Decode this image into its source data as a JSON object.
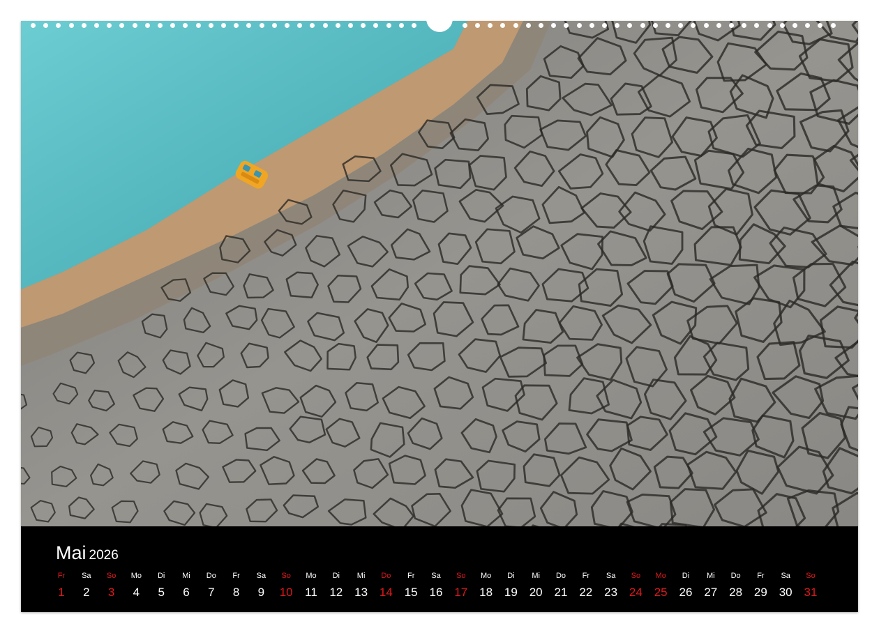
{
  "calendar": {
    "month": "Mai",
    "year": "2026",
    "holiday_color": "#e0181b",
    "days": [
      {
        "wd": "Fr",
        "d": "1",
        "holiday": true
      },
      {
        "wd": "Sa",
        "d": "2",
        "holiday": false
      },
      {
        "wd": "So",
        "d": "3",
        "holiday": true
      },
      {
        "wd": "Mo",
        "d": "4",
        "holiday": false
      },
      {
        "wd": "Di",
        "d": "5",
        "holiday": false
      },
      {
        "wd": "Mi",
        "d": "6",
        "holiday": false
      },
      {
        "wd": "Do",
        "d": "7",
        "holiday": false
      },
      {
        "wd": "Fr",
        "d": "8",
        "holiday": false
      },
      {
        "wd": "Sa",
        "d": "9",
        "holiday": false
      },
      {
        "wd": "So",
        "d": "10",
        "holiday": true
      },
      {
        "wd": "Mo",
        "d": "11",
        "holiday": false
      },
      {
        "wd": "Di",
        "d": "12",
        "holiday": false
      },
      {
        "wd": "Mi",
        "d": "13",
        "holiday": false
      },
      {
        "wd": "Do",
        "d": "14",
        "holiday": true
      },
      {
        "wd": "Fr",
        "d": "15",
        "holiday": false
      },
      {
        "wd": "Sa",
        "d": "16",
        "holiday": false
      },
      {
        "wd": "So",
        "d": "17",
        "holiday": true
      },
      {
        "wd": "Mo",
        "d": "18",
        "holiday": false
      },
      {
        "wd": "Di",
        "d": "19",
        "holiday": false
      },
      {
        "wd": "Mi",
        "d": "20",
        "holiday": false
      },
      {
        "wd": "Do",
        "d": "21",
        "holiday": false
      },
      {
        "wd": "Fr",
        "d": "22",
        "holiday": false
      },
      {
        "wd": "Sa",
        "d": "23",
        "holiday": false
      },
      {
        "wd": "So",
        "d": "24",
        "holiday": true
      },
      {
        "wd": "Mo",
        "d": "25",
        "holiday": true
      },
      {
        "wd": "Di",
        "d": "26",
        "holiday": false
      },
      {
        "wd": "Mi",
        "d": "27",
        "holiday": false
      },
      {
        "wd": "Do",
        "d": "28",
        "holiday": false
      },
      {
        "wd": "Fr",
        "d": "29",
        "holiday": false
      },
      {
        "wd": "Sa",
        "d": "30",
        "holiday": false
      },
      {
        "wd": "So",
        "d": "31",
        "holiday": true
      }
    ]
  },
  "photo": {
    "subject": "aerial-dry-cracked-lakebed",
    "colors": {
      "water": "#5bbcc0",
      "beach": "#c39a70",
      "mud": "#8e8c87",
      "crack": "#2b2926",
      "boat": "#f0a623"
    }
  }
}
